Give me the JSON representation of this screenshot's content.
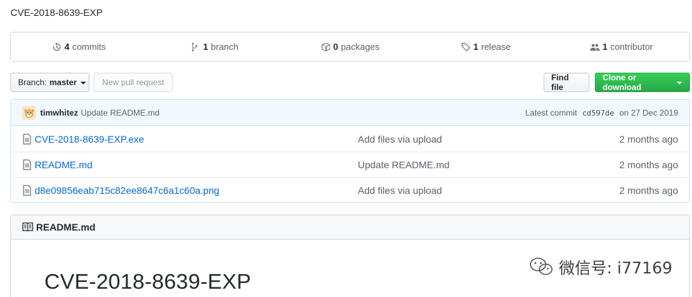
{
  "repo": {
    "description": "CVE-2018-8639-EXP"
  },
  "stats": {
    "commits": {
      "count": "4",
      "label": "commits"
    },
    "branches": {
      "count": "1",
      "label": "branch"
    },
    "packages": {
      "count": "0",
      "label": "packages"
    },
    "releases": {
      "count": "1",
      "label": "release"
    },
    "contributors": {
      "count": "1",
      "label": "contributor"
    }
  },
  "toolbar": {
    "branch_prefix": "Branch:",
    "branch_name": "master",
    "new_pr_label": "New pull request",
    "find_file_label": "Find file",
    "clone_label": "Clone or download"
  },
  "latest_commit": {
    "author": "timwhitez",
    "message": "Update README.md",
    "prefix": "Latest commit",
    "sha": "cd597de",
    "date_text": "on 27 Dec 2019"
  },
  "files": [
    {
      "name": "CVE-2018-8639-EXP.exe",
      "message": "Add files via upload",
      "age": "2 months ago"
    },
    {
      "name": "README.md",
      "message": "Update README.md",
      "age": "2 months ago"
    },
    {
      "name": "d8e09856eab715c82ee8647c6a1c60a.png",
      "message": "Add files via upload",
      "age": "2 months ago"
    }
  ],
  "readme": {
    "header": "README.md",
    "title": "CVE-2018-8639-EXP"
  },
  "watermark": {
    "text": "微信号: i77169"
  },
  "colors": {
    "accent": "#0366d6",
    "clone_green": "#28a745",
    "commit_bar": "#f1f8ff"
  }
}
